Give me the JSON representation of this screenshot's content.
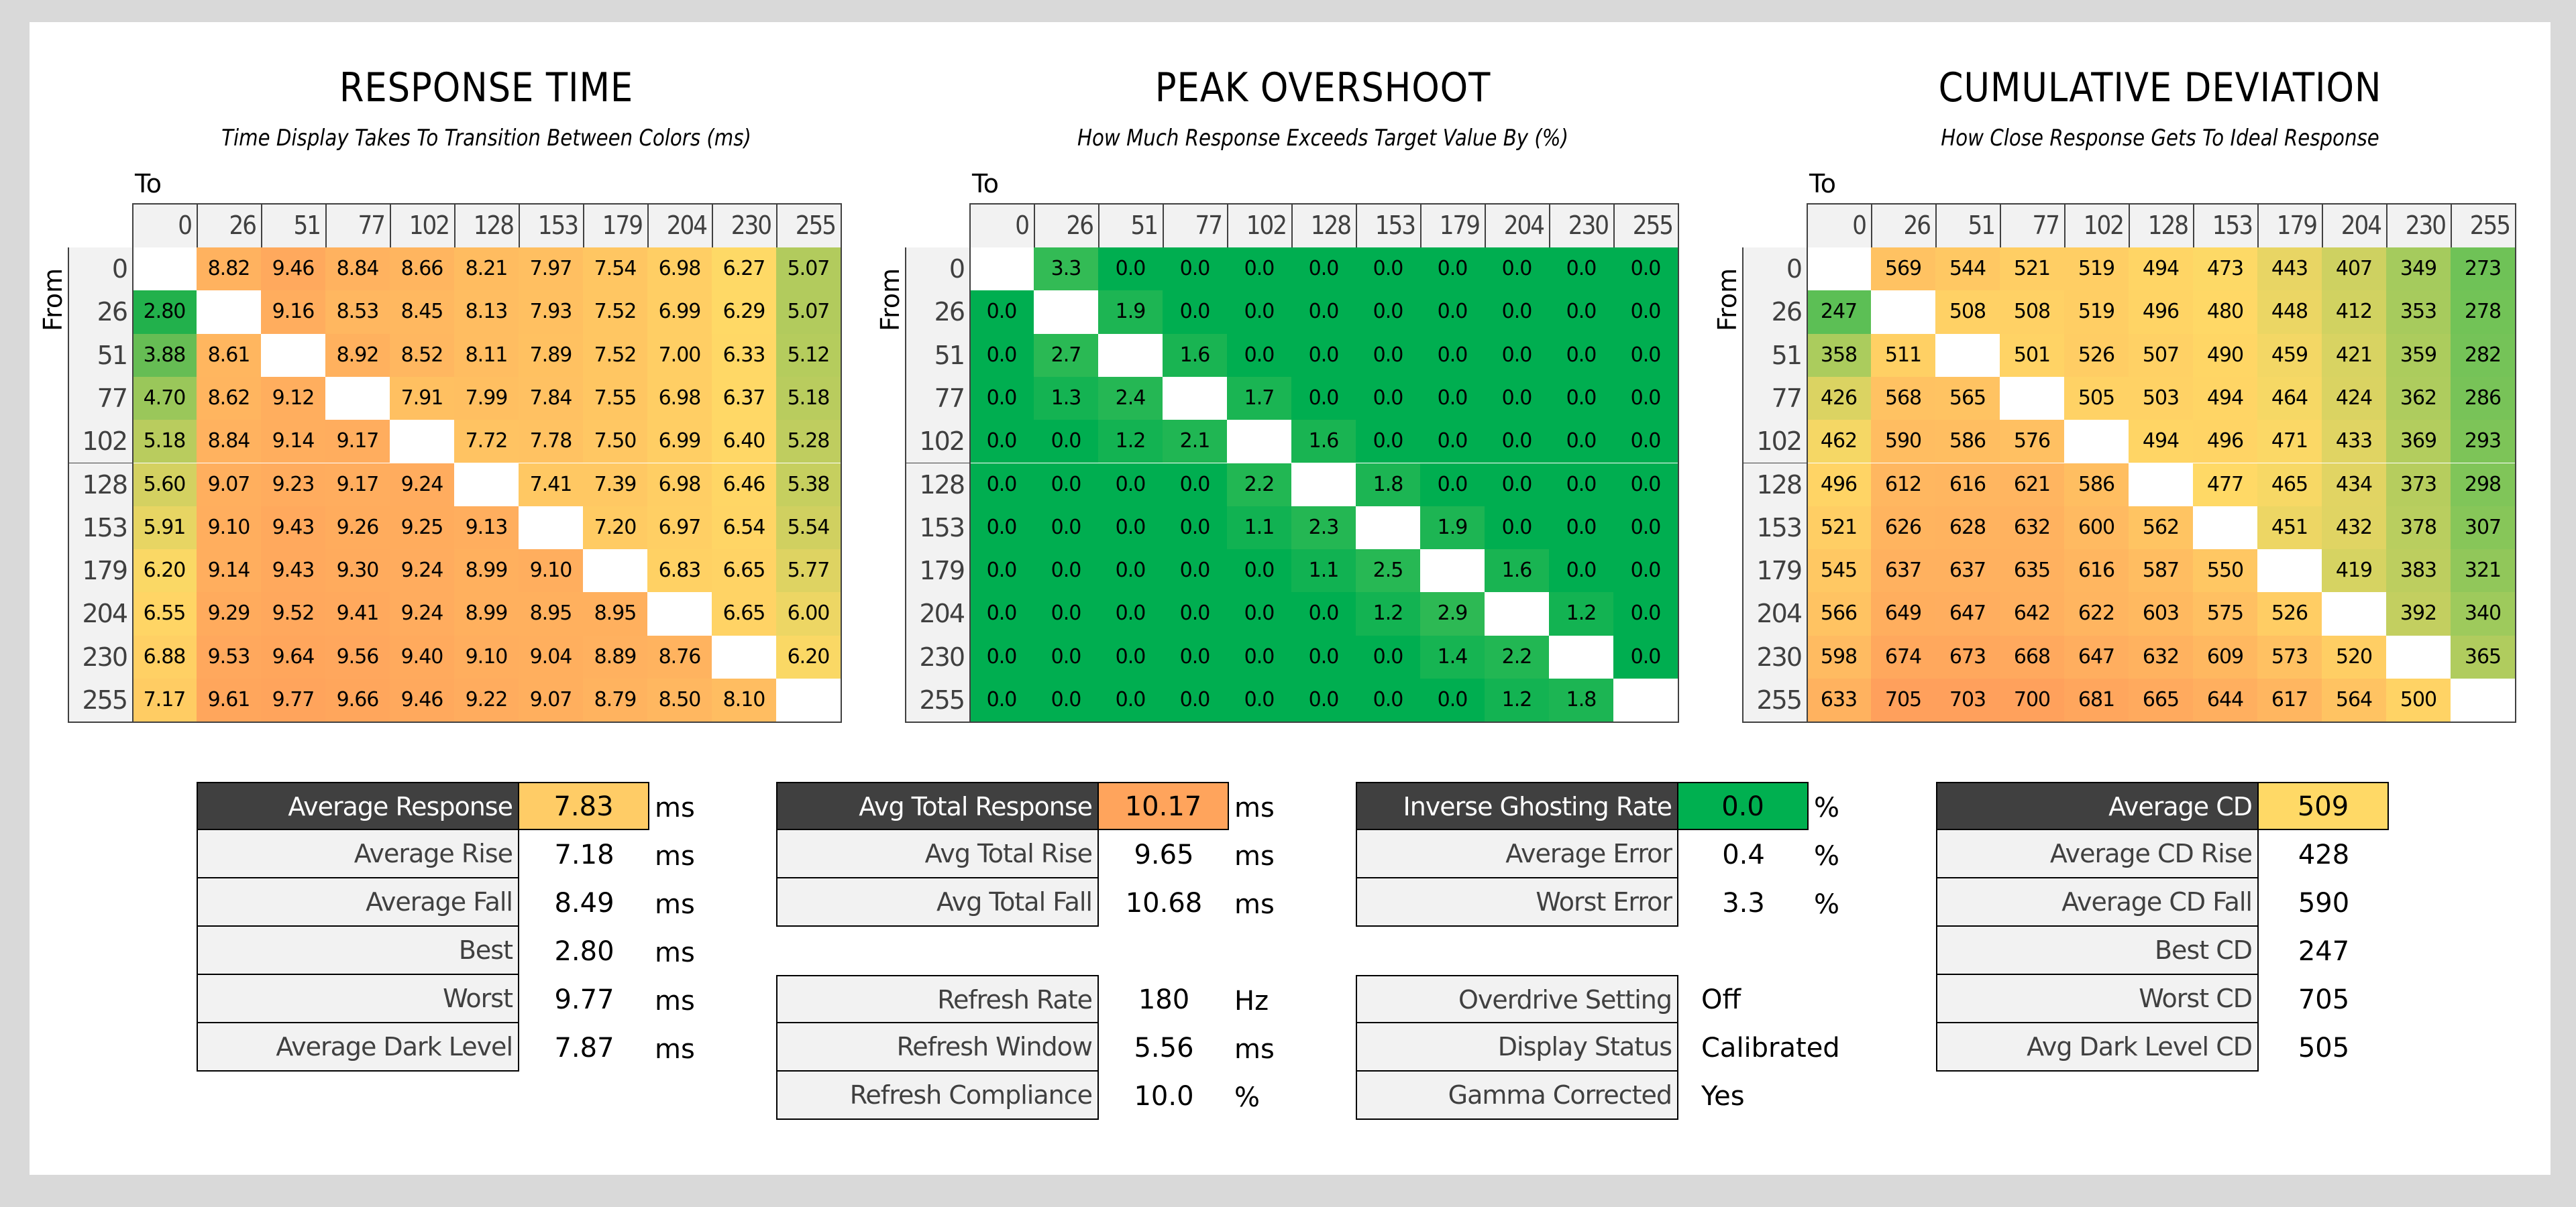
{
  "axis_labels": {
    "to": "To",
    "from": "From"
  },
  "levels": [
    0,
    26,
    51,
    77,
    102,
    128,
    153,
    179,
    204,
    230,
    255
  ],
  "chart_data": [
    {
      "type": "heatmap",
      "title": "RESPONSE TIME",
      "subtitle": "Time Display Takes To Transition Between Colors (ms)",
      "xlabel": "To",
      "ylabel": "From",
      "x": [
        0,
        26,
        51,
        77,
        102,
        128,
        153,
        179,
        204,
        230,
        255
      ],
      "y": [
        0,
        26,
        51,
        77,
        102,
        128,
        153,
        179,
        204,
        230,
        255
      ],
      "decimals": 2,
      "color_scale": {
        "low": "#22b14c",
        "mid": "#ffd966",
        "high": "#ffa45c"
      },
      "values": [
        [
          null,
          8.82,
          9.46,
          8.84,
          8.66,
          8.21,
          7.97,
          7.54,
          6.98,
          6.27,
          5.07
        ],
        [
          2.8,
          null,
          9.16,
          8.53,
          8.45,
          8.13,
          7.93,
          7.52,
          6.99,
          6.29,
          5.07
        ],
        [
          3.88,
          8.61,
          null,
          8.92,
          8.52,
          8.11,
          7.89,
          7.52,
          7.0,
          6.33,
          5.12
        ],
        [
          4.7,
          8.62,
          9.12,
          null,
          7.91,
          7.99,
          7.84,
          7.55,
          6.98,
          6.37,
          5.18
        ],
        [
          5.18,
          8.84,
          9.14,
          9.17,
          null,
          7.72,
          7.78,
          7.5,
          6.99,
          6.4,
          5.28
        ],
        [
          5.6,
          9.07,
          9.23,
          9.17,
          9.24,
          null,
          7.41,
          7.39,
          6.98,
          6.46,
          5.38
        ],
        [
          5.91,
          9.1,
          9.43,
          9.26,
          9.25,
          9.13,
          null,
          7.2,
          6.97,
          6.54,
          5.54
        ],
        [
          6.2,
          9.14,
          9.43,
          9.3,
          9.24,
          8.99,
          9.1,
          null,
          6.83,
          6.65,
          5.77
        ],
        [
          6.55,
          9.29,
          9.52,
          9.41,
          9.24,
          8.99,
          8.95,
          8.95,
          null,
          6.65,
          6.0
        ],
        [
          6.88,
          9.53,
          9.64,
          9.56,
          9.4,
          9.1,
          9.04,
          8.89,
          8.76,
          null,
          6.2
        ],
        [
          7.17,
          9.61,
          9.77,
          9.66,
          9.46,
          9.22,
          9.07,
          8.79,
          8.5,
          8.1,
          null
        ]
      ]
    },
    {
      "type": "heatmap",
      "title": "PEAK OVERSHOOT",
      "subtitle": "How Much Response Exceeds Target Value By (%)",
      "xlabel": "To",
      "ylabel": "From",
      "x": [
        0,
        26,
        51,
        77,
        102,
        128,
        153,
        179,
        204,
        230,
        255
      ],
      "y": [
        0,
        26,
        51,
        77,
        102,
        128,
        153,
        179,
        204,
        230,
        255
      ],
      "decimals": 1,
      "color_scale": {
        "low": "#00ae50",
        "high": "#33bb55"
      },
      "values": [
        [
          null,
          3.3,
          0.0,
          0.0,
          0.0,
          0.0,
          0.0,
          0.0,
          0.0,
          0.0,
          0.0
        ],
        [
          0.0,
          null,
          1.9,
          0.0,
          0.0,
          0.0,
          0.0,
          0.0,
          0.0,
          0.0,
          0.0
        ],
        [
          0.0,
          2.7,
          null,
          1.6,
          0.0,
          0.0,
          0.0,
          0.0,
          0.0,
          0.0,
          0.0
        ],
        [
          0.0,
          1.3,
          2.4,
          null,
          1.7,
          0.0,
          0.0,
          0.0,
          0.0,
          0.0,
          0.0
        ],
        [
          0.0,
          0.0,
          1.2,
          2.1,
          null,
          1.6,
          0.0,
          0.0,
          0.0,
          0.0,
          0.0
        ],
        [
          0.0,
          0.0,
          0.0,
          0.0,
          2.2,
          null,
          1.8,
          0.0,
          0.0,
          0.0,
          0.0
        ],
        [
          0.0,
          0.0,
          0.0,
          0.0,
          1.1,
          2.3,
          null,
          1.9,
          0.0,
          0.0,
          0.0
        ],
        [
          0.0,
          0.0,
          0.0,
          0.0,
          0.0,
          1.1,
          2.5,
          null,
          1.6,
          0.0,
          0.0
        ],
        [
          0.0,
          0.0,
          0.0,
          0.0,
          0.0,
          0.0,
          1.2,
          2.9,
          null,
          1.2,
          0.0
        ],
        [
          0.0,
          0.0,
          0.0,
          0.0,
          0.0,
          0.0,
          0.0,
          1.4,
          2.2,
          null,
          0.0
        ],
        [
          0.0,
          0.0,
          0.0,
          0.0,
          0.0,
          0.0,
          0.0,
          0.0,
          1.2,
          1.8,
          null
        ]
      ]
    },
    {
      "type": "heatmap",
      "title": "CUMULATIVE DEVIATION",
      "subtitle": "How Close Response Gets To Ideal Response",
      "xlabel": "To",
      "ylabel": "From",
      "x": [
        0,
        26,
        51,
        77,
        102,
        128,
        153,
        179,
        204,
        230,
        255
      ],
      "y": [
        0,
        26,
        51,
        77,
        102,
        128,
        153,
        179,
        204,
        230,
        255
      ],
      "decimals": 0,
      "color_scale": {
        "low": "#5cbf55",
        "mid": "#ffd966",
        "high": "#ffa05c"
      },
      "values": [
        [
          null,
          569,
          544,
          521,
          519,
          494,
          473,
          443,
          407,
          349,
          273
        ],
        [
          247,
          null,
          508,
          508,
          519,
          496,
          480,
          448,
          412,
          353,
          278
        ],
        [
          358,
          511,
          null,
          501,
          526,
          507,
          490,
          459,
          421,
          359,
          282
        ],
        [
          426,
          568,
          565,
          null,
          505,
          503,
          494,
          464,
          424,
          362,
          286
        ],
        [
          462,
          590,
          586,
          576,
          null,
          494,
          496,
          471,
          433,
          369,
          293
        ],
        [
          496,
          612,
          616,
          621,
          586,
          null,
          477,
          465,
          434,
          373,
          298
        ],
        [
          521,
          626,
          628,
          632,
          600,
          562,
          null,
          451,
          432,
          378,
          307
        ],
        [
          545,
          637,
          637,
          635,
          616,
          587,
          550,
          null,
          419,
          383,
          321
        ],
        [
          566,
          649,
          647,
          642,
          622,
          603,
          575,
          526,
          null,
          392,
          340
        ],
        [
          598,
          674,
          673,
          668,
          647,
          632,
          609,
          573,
          520,
          null,
          365
        ],
        [
          633,
          705,
          703,
          700,
          681,
          665,
          644,
          617,
          564,
          500,
          null
        ]
      ]
    }
  ],
  "stats": {
    "response": {
      "headline": {
        "label": "Average Response",
        "value": "7.83",
        "unit": "ms",
        "color": "#ffcc66"
      },
      "rows": [
        {
          "label": "Average Rise",
          "value": "7.18",
          "unit": "ms"
        },
        {
          "label": "Average Fall",
          "value": "8.49",
          "unit": "ms"
        },
        {
          "label": "Best",
          "value": "2.80",
          "unit": "ms"
        },
        {
          "label": "Worst",
          "value": "9.77",
          "unit": "ms"
        },
        {
          "label": "Average Dark Level",
          "value": "7.87",
          "unit": "ms"
        }
      ]
    },
    "total": {
      "headline": {
        "label": "Avg Total Response",
        "value": "10.17",
        "unit": "ms",
        "color": "#ffa45c"
      },
      "rows": [
        {
          "label": "Avg Total Rise",
          "value": "9.65",
          "unit": "ms"
        },
        {
          "label": "Avg Total Fall",
          "value": "10.68",
          "unit": "ms"
        }
      ]
    },
    "refresh": {
      "rows": [
        {
          "label": "Refresh Rate",
          "value": "180",
          "unit": "Hz"
        },
        {
          "label": "Refresh Window",
          "value": "5.56",
          "unit": "ms"
        },
        {
          "label": "Refresh Compliance",
          "value": "10.0",
          "unit": "%"
        }
      ]
    },
    "overshoot": {
      "headline": {
        "label": "Inverse Ghosting Rate",
        "value": "0.0",
        "unit": "%",
        "color": "#00b050"
      },
      "rows": [
        {
          "label": "Average Error",
          "value": "0.4",
          "unit": "%"
        },
        {
          "label": "Worst Error",
          "value": "3.3",
          "unit": "%"
        }
      ]
    },
    "settings": {
      "rows": [
        {
          "label": "Overdrive Setting",
          "value": "Off"
        },
        {
          "label": "Display Status",
          "value": "Calibrated"
        },
        {
          "label": "Gamma Corrected",
          "value": "Yes"
        }
      ]
    },
    "cd": {
      "headline": {
        "label": "Average CD",
        "value": "509",
        "color": "#ffd966"
      },
      "rows": [
        {
          "label": "Average CD Rise",
          "value": "428"
        },
        {
          "label": "Average CD Fall",
          "value": "590"
        },
        {
          "label": "Best CD",
          "value": "247"
        },
        {
          "label": "Worst CD",
          "value": "705"
        },
        {
          "label": "Avg Dark Level CD",
          "value": "505"
        }
      ]
    }
  }
}
